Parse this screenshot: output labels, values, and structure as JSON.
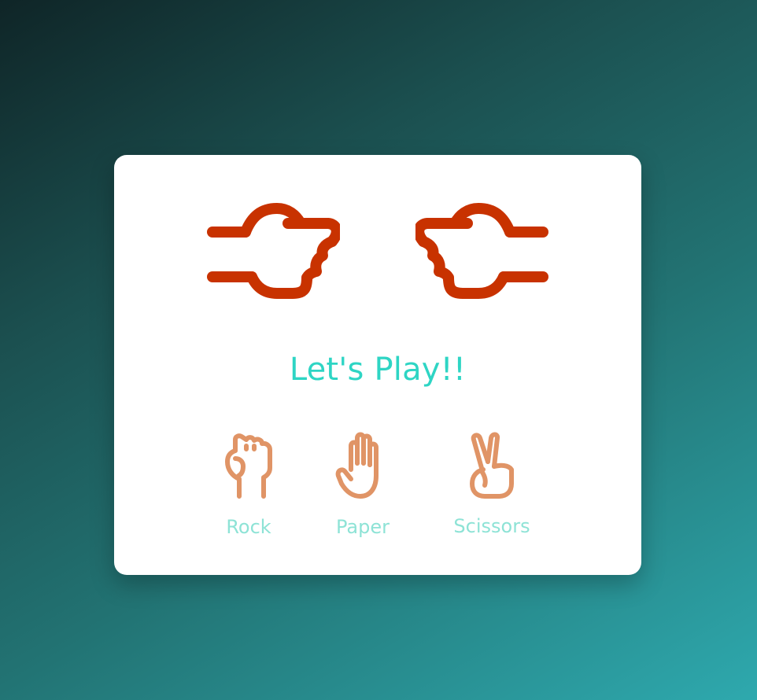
{
  "game": {
    "status": "Let's Play!!",
    "player_hand_icon": "fist-pointing-right-icon",
    "computer_hand_icon": "fist-pointing-left-icon"
  },
  "options": [
    {
      "label": "Rock",
      "icon": "rock-hand-icon"
    },
    {
      "label": "Paper",
      "icon": "paper-hand-icon"
    },
    {
      "label": "Scissors",
      "icon": "scissors-hand-icon"
    }
  ],
  "colors": {
    "result_hand": "#c83200",
    "option_icon": "#e09466",
    "status_text": "#2ed5c4",
    "option_label": "#8ee3d6",
    "card_bg": "#ffffff"
  }
}
